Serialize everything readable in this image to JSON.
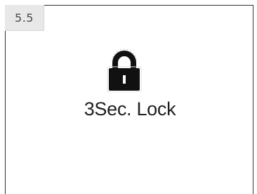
{
  "step": {
    "number": "5.5"
  },
  "screen": {
    "icon": "padlock-icon",
    "label": "3Sec. Lock"
  }
}
